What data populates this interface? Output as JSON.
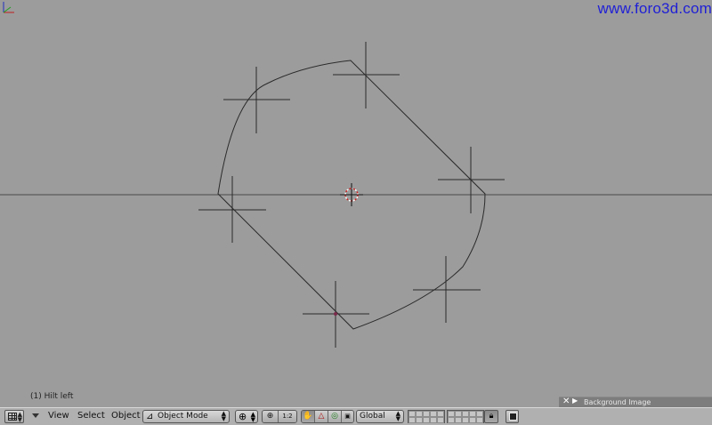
{
  "watermark": "www.foro3d.com",
  "viewport": {
    "object_label": "(1) Hilt left",
    "background_image_panel": {
      "close_icon": "close-icon",
      "expand_icon": "play-arrow-icon",
      "label": "Background Image"
    }
  },
  "header": {
    "editor_type_icon": "view3d-grid-icon",
    "menus": [
      "View",
      "Select",
      "Object"
    ],
    "mode": "Object Mode",
    "mode_icon": "object-mode-icon",
    "pivot_icon": "pivot-point-icon",
    "manipulator_labels": [
      "1:2"
    ],
    "orientation": "Global",
    "lock_icon": "lock-icon",
    "render_icon": "render-icon"
  },
  "colors": {
    "viewport_bg": "#9c9c9c",
    "header_bg": "#b0b0b0",
    "curve": "#2a2a2a",
    "watermark": "#1f1fd6",
    "cursor": "#cc2222"
  }
}
